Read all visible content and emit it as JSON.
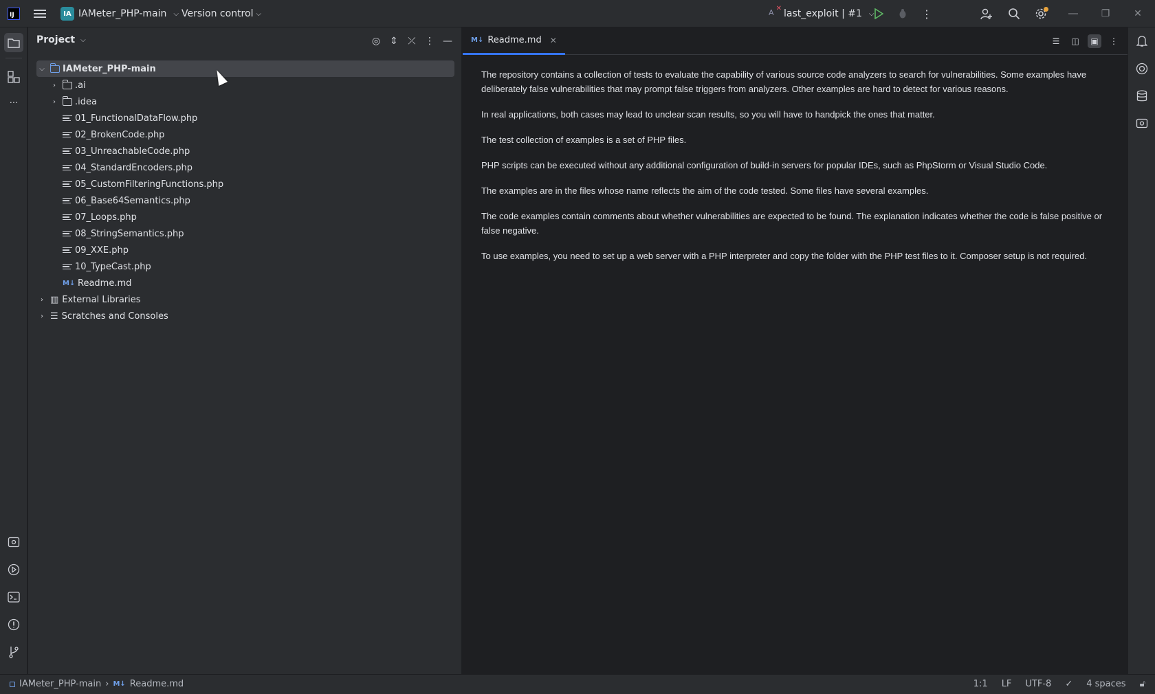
{
  "titlebar": {
    "app_logo": "IJ",
    "project_badge": "IA",
    "project_name": "IAMeter_PHP-main",
    "vcs_label": "Version control",
    "run_config": "last_exploit | #1",
    "icons": [
      "hamburger-menu-icon",
      "chevron-down-icon",
      "run-icon",
      "debug-icon",
      "more-vertical-icon",
      "add-user-icon",
      "search-icon",
      "settings-icon",
      "minimize-icon",
      "restore-icon",
      "close-icon"
    ],
    "accent_color": "#3574f0",
    "badge_color": "#2a8c9c",
    "run_color": "#5fb865"
  },
  "left_strip": {
    "items": [
      "project-icon",
      "structure-icon",
      "more-icon",
      "services-icon",
      "run-icon",
      "terminal-icon",
      "problems-icon",
      "git-icon"
    ]
  },
  "project_panel": {
    "title": "Project",
    "tools": [
      "locate-icon",
      "expand-all-icon",
      "collapse-all-icon",
      "more-vertical-icon",
      "hide-icon"
    ],
    "tree": [
      {
        "label": "IAMeter_PHP-main",
        "kind": "module",
        "depth": 0,
        "expanded": true,
        "selected": true
      },
      {
        "label": ".ai",
        "kind": "folder",
        "depth": 1,
        "expanded": false
      },
      {
        "label": ".idea",
        "kind": "folder",
        "depth": 1,
        "expanded": false
      },
      {
        "label": "01_FunctionalDataFlow.php",
        "kind": "file",
        "depth": 1
      },
      {
        "label": "02_BrokenCode.php",
        "kind": "file",
        "depth": 1
      },
      {
        "label": "03_UnreachableCode.php",
        "kind": "file",
        "depth": 1
      },
      {
        "label": "04_StandardEncoders.php",
        "kind": "file",
        "depth": 1
      },
      {
        "label": "05_CustomFilteringFunctions.php",
        "kind": "file",
        "depth": 1
      },
      {
        "label": "06_Base64Semantics.php",
        "kind": "file",
        "depth": 1
      },
      {
        "label": "07_Loops.php",
        "kind": "file",
        "depth": 1
      },
      {
        "label": "08_StringSemantics.php",
        "kind": "file",
        "depth": 1
      },
      {
        "label": "09_XXE.php",
        "kind": "file",
        "depth": 1
      },
      {
        "label": "10_TypeCast.php",
        "kind": "file",
        "depth": 1
      },
      {
        "label": "Readme.md",
        "kind": "markdown",
        "depth": 1
      },
      {
        "label": "External Libraries",
        "kind": "library",
        "depth": 0,
        "expanded": false
      },
      {
        "label": "Scratches and Consoles",
        "kind": "scratches",
        "depth": 0,
        "expanded": false
      }
    ]
  },
  "editor": {
    "tab": {
      "icon_text": "M↓",
      "label": "Readme.md"
    },
    "view_modes": [
      "editor-only-icon",
      "split-view-icon",
      "preview-only-icon",
      "more-vertical-icon"
    ],
    "paragraphs": [
      "The repository contains a collection of tests to evaluate the capability of various source code analyzers to search for vulnerabilities. Some examples have deliberately false vulnerabilities that may prompt false triggers from analyzers. Other examples are hard to detect for various reasons.",
      "In real applications, both cases may lead to unclear scan results, so you will have to handpick the ones that matter.",
      "The test collection of examples is a set of PHP files.",
      "PHP scripts can be executed without any additional configuration of build-in servers for popular IDEs, such as PhpStorm or Visual Studio Code.",
      "The examples are in the files whose name reflects the aim of the code tested. Some files have several examples.",
      "The code examples contain comments about whether vulnerabilities are expected to be found. The explanation indicates whether the code is false positive or false negative.",
      "To use examples, you need to set up a web server with a PHP interpreter and copy the folder with the PHP test files to it. Composer setup is not required."
    ]
  },
  "right_strip": {
    "items": [
      "notifications-icon",
      "ai-assistant-icon",
      "database-icon",
      "code-with-me-icon"
    ]
  },
  "statusbar": {
    "project": "IAMeter_PHP-main",
    "file_icon": "M↓",
    "file": "Readme.md",
    "position": "1:1",
    "line_sep": "LF",
    "encoding": "UTF-8",
    "indent": "4 spaces"
  }
}
